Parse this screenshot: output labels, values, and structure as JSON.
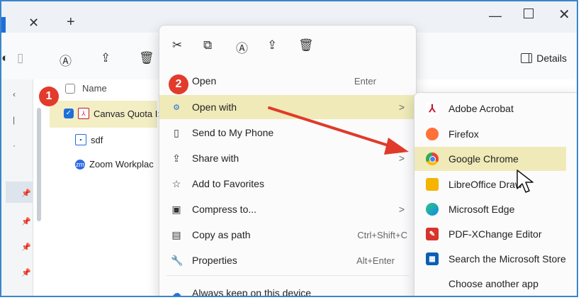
{
  "window": {
    "tab_close": "✕",
    "tab_new": "+",
    "minimize": "—",
    "close": "✕"
  },
  "toolbar": {
    "details_label": "Details"
  },
  "file_list": {
    "column_name": "Name",
    "files": [
      {
        "name": "Canvas Quota I:",
        "icon": "pdf-icon",
        "selected": true
      },
      {
        "name": "sdf",
        "icon": "document-icon",
        "selected": false
      },
      {
        "name": "Zoom Workplac",
        "icon": "zoom-icon",
        "selected": false
      }
    ]
  },
  "badges": {
    "step1": "1",
    "step2": "2"
  },
  "context_menu": {
    "top_actions": [
      "cut-icon",
      "copy-icon",
      "rename-icon",
      "share-icon",
      "delete-icon"
    ],
    "items": [
      {
        "label": "Open",
        "shortcut": "Enter",
        "icon": "open-icon"
      },
      {
        "label": "Open with",
        "shortcut": "",
        "icon": "open-with-icon",
        "arrow": ">"
      },
      {
        "label": "Send to My Phone",
        "shortcut": "",
        "icon": "phone-icon"
      },
      {
        "label": "Share with",
        "shortcut": "",
        "icon": "share-icon",
        "arrow": ">"
      },
      {
        "label": "Add to Favorites",
        "shortcut": "",
        "icon": "star-icon"
      },
      {
        "label": "Compress to...",
        "shortcut": "",
        "icon": "zip-icon",
        "arrow": ">"
      },
      {
        "label": "Copy as path",
        "shortcut": "Ctrl+Shift+C",
        "icon": "path-icon"
      },
      {
        "label": "Properties",
        "shortcut": "Alt+Enter",
        "icon": "wrench-icon"
      },
      {
        "label": "Always keep on this device",
        "shortcut": "",
        "icon": "cloud-icon"
      }
    ]
  },
  "open_with_menu": {
    "items": [
      {
        "label": "Adobe Acrobat",
        "icon": "acrobat-icon",
        "color": "#c8102e"
      },
      {
        "label": "Firefox",
        "icon": "firefox-icon",
        "color": "#ff7139"
      },
      {
        "label": "Google Chrome",
        "icon": "chrome-icon",
        "color": "#4285f4"
      },
      {
        "label": "LibreOffice Draw",
        "icon": "libreoffice-draw-icon",
        "color": "#f4b400"
      },
      {
        "label": "Microsoft Edge",
        "icon": "edge-icon",
        "color": "#0c8ce9"
      },
      {
        "label": "PDF-XChange Editor",
        "icon": "pdf-xchange-icon",
        "color": "#d7342b"
      },
      {
        "label": "Search the Microsoft Store",
        "icon": "store-icon",
        "color": "#0a5fb4"
      },
      {
        "label": "Choose another app",
        "icon": "",
        "color": ""
      }
    ]
  },
  "colors": {
    "highlight": "#efeab8",
    "badge": "#e23b2c",
    "annotation_arrow": "#e03a2a",
    "frame": "#3b86c9"
  }
}
